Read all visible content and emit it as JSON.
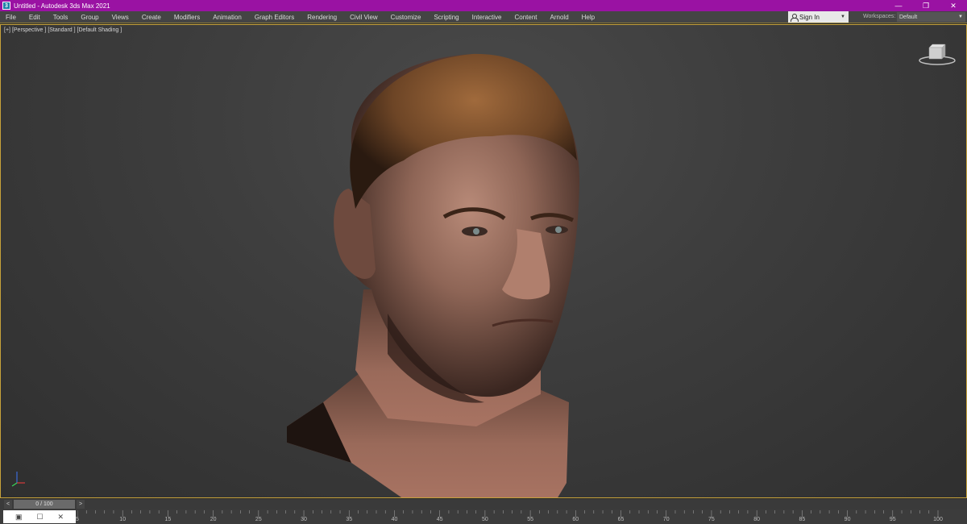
{
  "window": {
    "title": "Untitled - Autodesk 3ds Max 2021",
    "app_icon_glyph": "3",
    "controls": {
      "minimize": "—",
      "restore": "❐",
      "close": "✕"
    }
  },
  "colors": {
    "titlebar": "#9a12a3",
    "viewport_border": "#c7a23a",
    "menu_bg": "#444444"
  },
  "menu": {
    "items": [
      "File",
      "Edit",
      "Tools",
      "Group",
      "Views",
      "Create",
      "Modifiers",
      "Animation",
      "Graph Editors",
      "Rendering",
      "Civil View",
      "Customize",
      "Scripting",
      "Interactive",
      "Content",
      "Arnold",
      "Help"
    ],
    "sign_in": "Sign In",
    "workspaces_label": "Workspaces:",
    "workspace_value": "Default"
  },
  "viewport": {
    "label_plus": "[+]",
    "label_view": "[Perspective ]",
    "label_mode": "[Standard ]",
    "label_shading": "[Default Shading ]",
    "viewcube_icon": "viewcube",
    "tripod_icon": "axis-tripod",
    "model": "head-bust"
  },
  "timeline": {
    "prev": "<",
    "next": ">",
    "frame_display": "0 / 100"
  },
  "trackbar": {
    "ticks": [
      "5",
      "10",
      "15",
      "20",
      "25",
      "30",
      "35",
      "40",
      "45",
      "50",
      "55",
      "60",
      "65",
      "70",
      "75",
      "80",
      "85",
      "90",
      "95",
      "100"
    ]
  },
  "mini_window": {
    "icon1": "▣",
    "icon2": "☐",
    "icon3": "✕"
  }
}
